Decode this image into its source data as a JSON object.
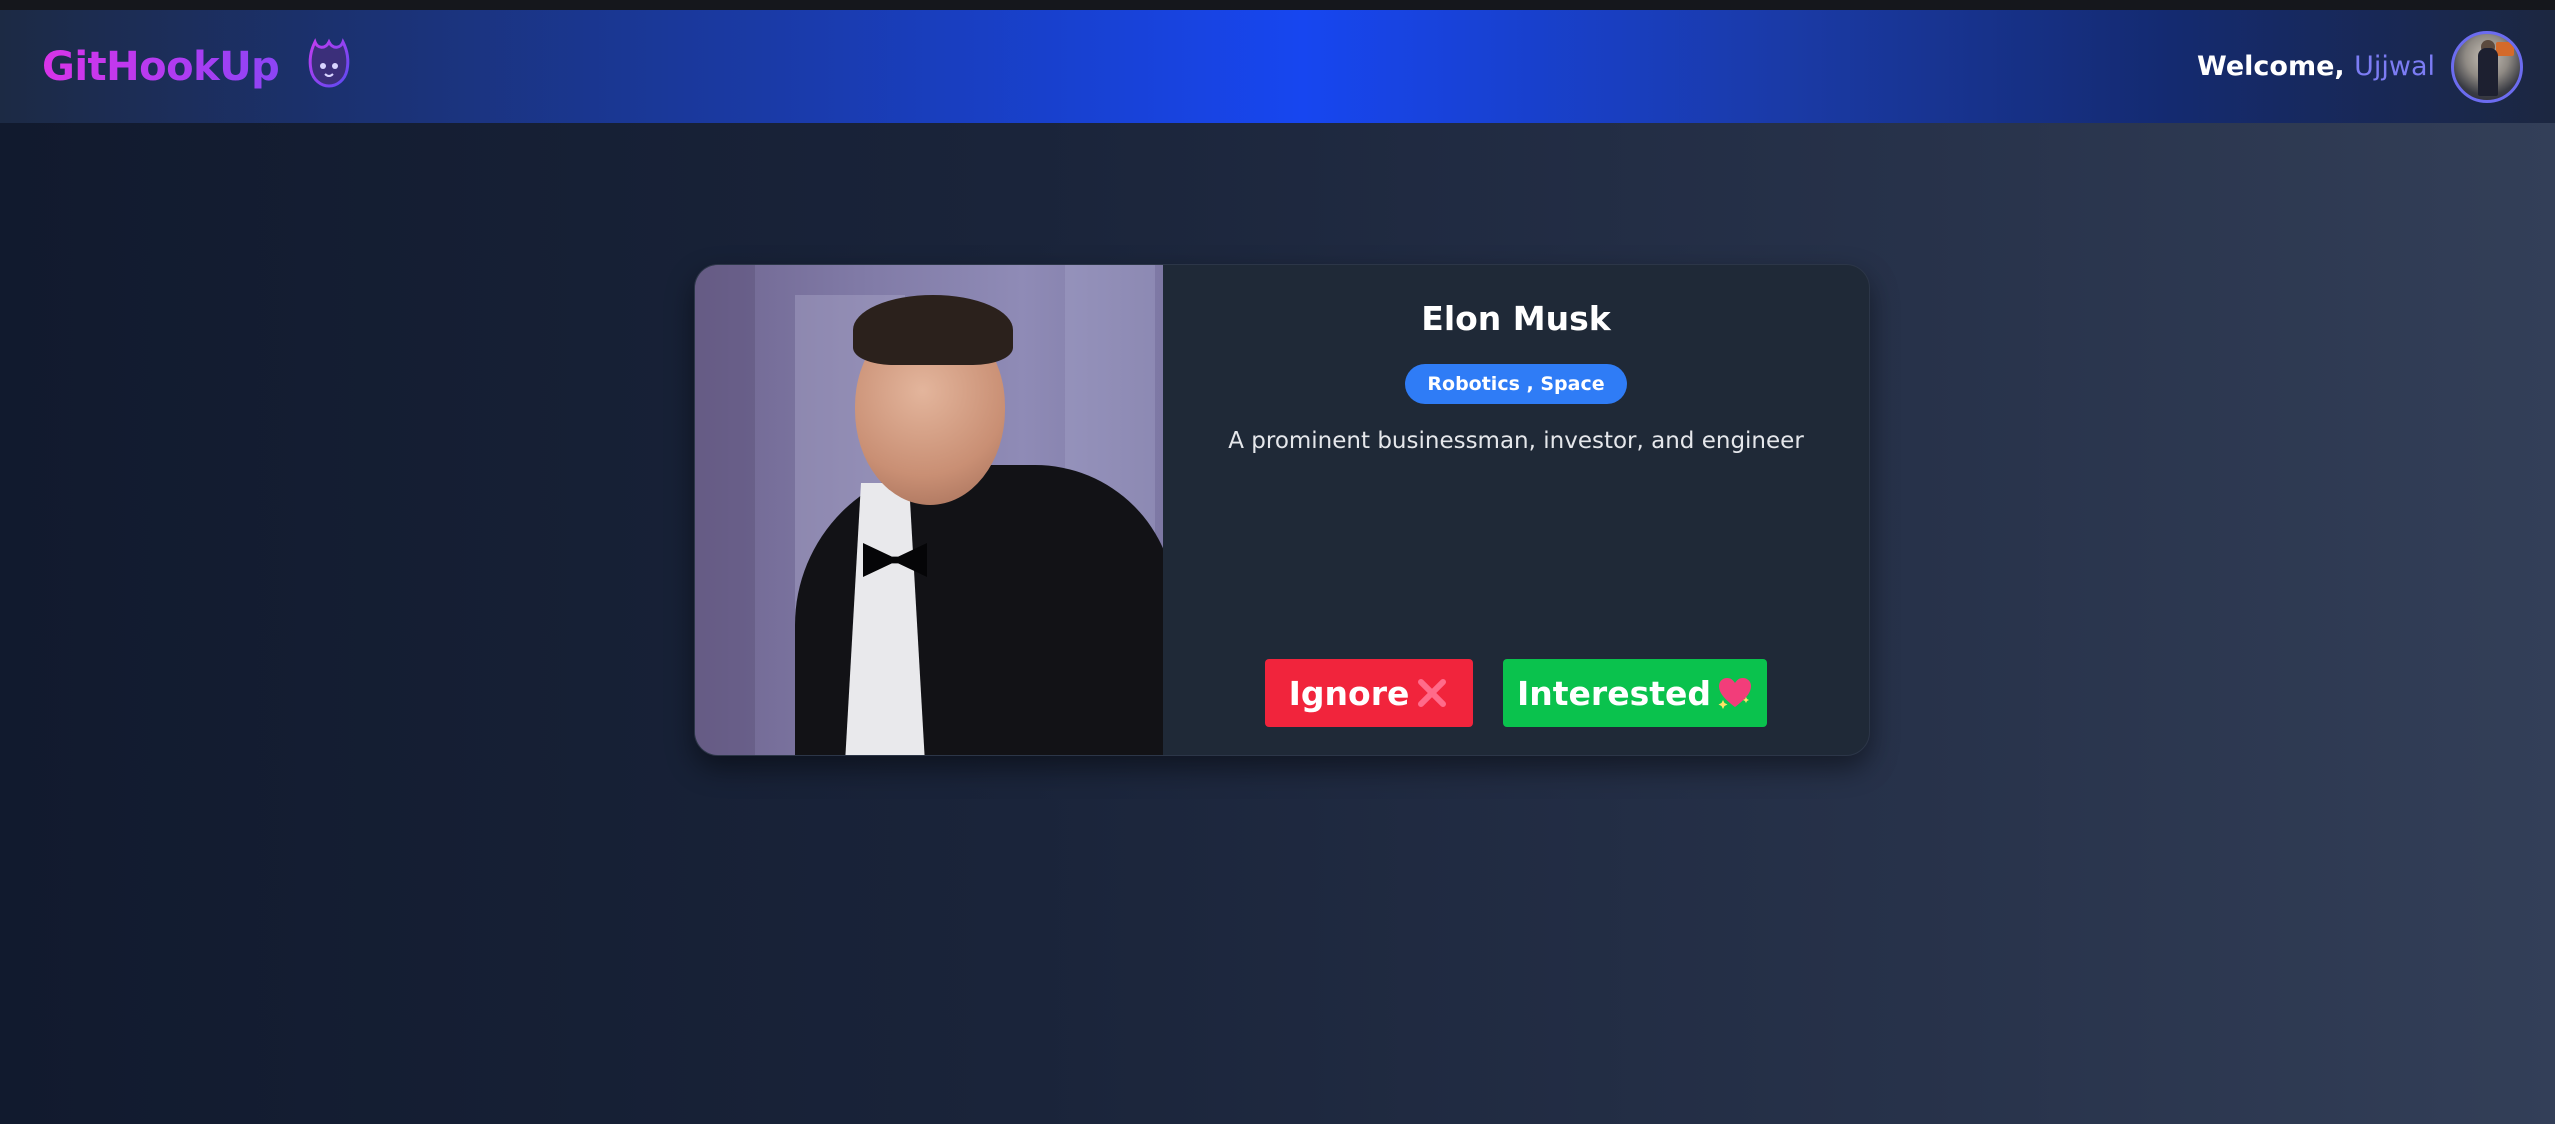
{
  "navbar": {
    "brand": "GitHookUp",
    "logo_icon": "flame-cat-icon",
    "welcome_prefix": "Welcome,",
    "user_name": "Ujjwal",
    "avatar_icon": "user-avatar"
  },
  "profile": {
    "name": "Elon Musk",
    "skills": "Robotics , Space",
    "about": "A prominent businessman, investor, and engineer",
    "photo_alt": "Elon Musk"
  },
  "actions": {
    "ignore_label": "Ignore",
    "ignore_icon": "cross-mark-icon",
    "interested_label": "Interested",
    "interested_icon": "sparkling-heart-icon"
  },
  "colors": {
    "brand_gradient_start": "#d834e8",
    "brand_gradient_end": "#8b45f5",
    "username": "#7c7cf4",
    "tag_bg": "#2f7cf6",
    "ignore_bg": "#f1243c",
    "interested_bg": "#0ac24d",
    "card_bg": "#1f2937"
  }
}
